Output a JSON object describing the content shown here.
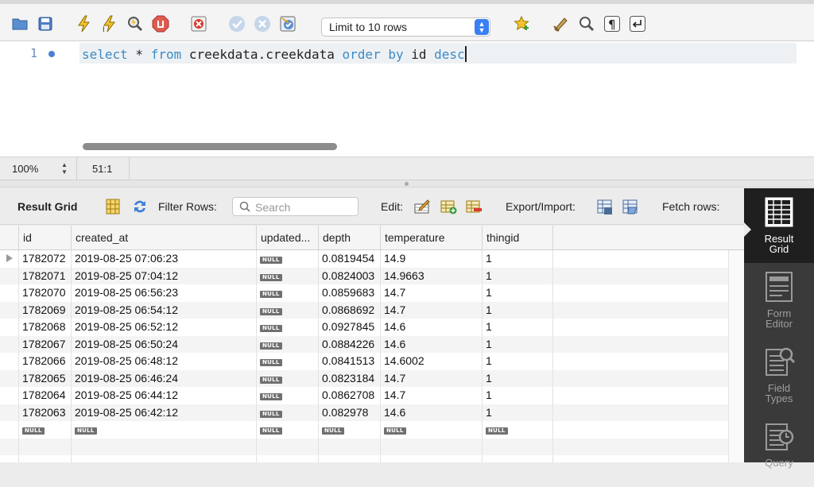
{
  "toolbar": {
    "limit_select": "Limit to 10 rows",
    "icons": [
      "open-folder-icon",
      "save-icon",
      "execute-icon",
      "execute-current-icon",
      "explain-icon",
      "stop-icon",
      "toggle-error-icon",
      "commit-icon",
      "rollback-icon",
      "autocommit-icon",
      "beautify-icon",
      "find-icon",
      "invisible-chars-icon",
      "wrap-icon",
      "bookmark-icon"
    ]
  },
  "editor": {
    "line_number": "1",
    "sql": {
      "kw1": "select",
      "t1": " * ",
      "kw2": "from",
      "t2": " creekdata.creekdata ",
      "kw3": "order by",
      "t3": " id ",
      "kw4": "desc"
    }
  },
  "status": {
    "zoom": "100%",
    "cursor_pos": "51:1"
  },
  "result_toolbar": {
    "tab": "Result Grid",
    "filter_label": "Filter Rows:",
    "search_placeholder": "Search",
    "edit_label": "Edit:",
    "export_label": "Export/Import:",
    "fetch_label": "Fetch rows:"
  },
  "grid": {
    "columns": [
      "id",
      "created_at",
      "updated...",
      "depth",
      "temperature",
      "thingid"
    ],
    "null_label": "NULL",
    "rows": [
      [
        "1782072",
        "2019-08-25 07:06:23",
        "NULL",
        "0.0819454",
        "14.9",
        "1"
      ],
      [
        "1782071",
        "2019-08-25 07:04:12",
        "NULL",
        "0.0824003",
        "14.9663",
        "1"
      ],
      [
        "1782070",
        "2019-08-25 06:56:23",
        "NULL",
        "0.0859683",
        "14.7",
        "1"
      ],
      [
        "1782069",
        "2019-08-25 06:54:12",
        "NULL",
        "0.0868692",
        "14.7",
        "1"
      ],
      [
        "1782068",
        "2019-08-25 06:52:12",
        "NULL",
        "0.0927845",
        "14.6",
        "1"
      ],
      [
        "1782067",
        "2019-08-25 06:50:24",
        "NULL",
        "0.0884226",
        "14.6",
        "1"
      ],
      [
        "1782066",
        "2019-08-25 06:48:12",
        "NULL",
        "0.0841513",
        "14.6002",
        "1"
      ],
      [
        "1782065",
        "2019-08-25 06:46:24",
        "NULL",
        "0.0823184",
        "14.7",
        "1"
      ],
      [
        "1782064",
        "2019-08-25 06:44:12",
        "NULL",
        "0.0862708",
        "14.7",
        "1"
      ],
      [
        "1782063",
        "2019-08-25 06:42:12",
        "NULL",
        "0.082978",
        "14.6",
        "1"
      ],
      [
        "NULL",
        "NULL",
        "NULL",
        "NULL",
        "NULL",
        "NULL"
      ]
    ]
  },
  "side_panel": {
    "items": [
      {
        "line1": "Result",
        "line2": "Grid"
      },
      {
        "line1": "Form",
        "line2": "Editor"
      },
      {
        "line1": "Field",
        "line2": "Types"
      },
      {
        "line1": "Query",
        "line2": ""
      }
    ]
  }
}
